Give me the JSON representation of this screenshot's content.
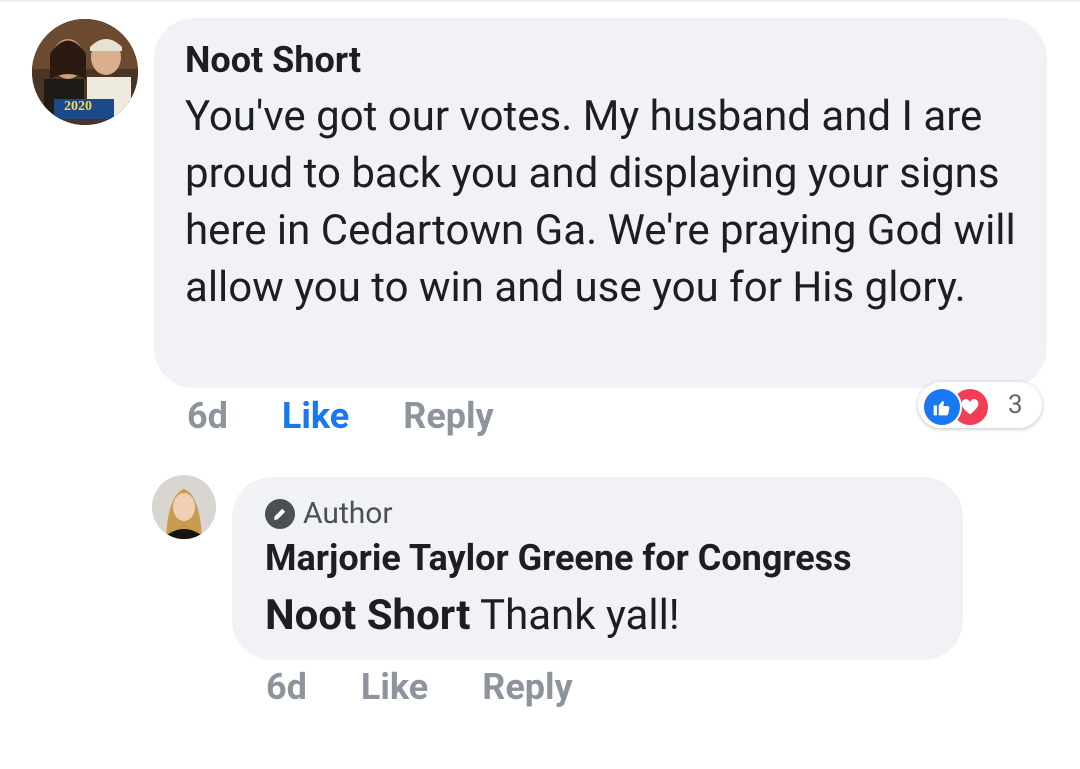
{
  "comment": {
    "author": "Noot Short",
    "avatar_badge": "2020",
    "text": "You've got our votes.  My husband and I are proud to back you and displaying your signs here in Cedartown Ga.  We're praying God will allow you to win and use you for His glory.",
    "time": "6d",
    "like_label": "Like",
    "reply_label": "Reply",
    "reactions": {
      "icons": [
        "like-icon",
        "love-icon"
      ],
      "count": "3"
    }
  },
  "reply": {
    "badge": "Author",
    "author": "Marjorie Taylor Greene for Congress",
    "mention": "Noot Short",
    "text": " Thank yall!",
    "time": "6d",
    "like_label": "Like",
    "reply_label": "Reply"
  },
  "colors": {
    "bubble": "#f0f2f5",
    "like_active": "#1877f2",
    "muted": "#8d949e",
    "love": "#f33e58"
  }
}
